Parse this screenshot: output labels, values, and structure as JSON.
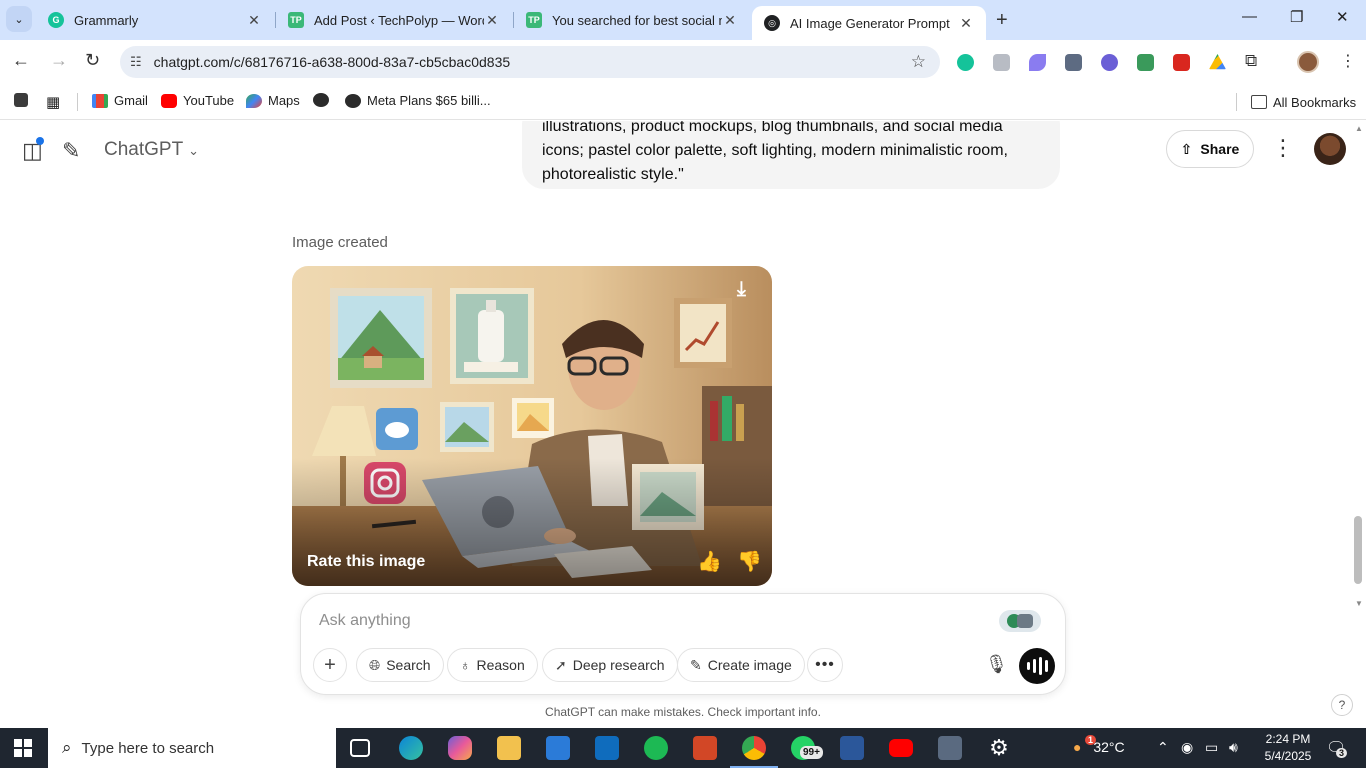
{
  "browser": {
    "tabs": [
      {
        "title": "Grammarly",
        "favicon": "grammarly-icon",
        "color": "#15c39a"
      },
      {
        "title": "Add Post ‹ TechPolyp — WordP",
        "favicon": "techpolyp-icon",
        "color": "#3bb878"
      },
      {
        "title": "You searched for best social me",
        "favicon": "techpolyp-icon",
        "color": "#3bb878"
      },
      {
        "title": "AI Image Generator Prompt",
        "favicon": "chatgpt-icon",
        "color": "#202123"
      }
    ],
    "url": "chatgpt.com/c/68176716-a638-800d-83a7-cb5cbac0d835",
    "bookmarks": [
      {
        "label": "Gmail",
        "icon": "gmail-icon"
      },
      {
        "label": "YouTube",
        "icon": "youtube-icon"
      },
      {
        "label": "Maps",
        "icon": "maps-icon"
      },
      {
        "label": "",
        "icon": "globe-icon"
      },
      {
        "label": "Meta Plans $65 billi...",
        "icon": "globe-icon"
      }
    ],
    "all_bookmarks": "All Bookmarks"
  },
  "chat": {
    "model": "ChatGPT",
    "share_label": "Share",
    "user_message": "illustrations, product mockups, blog thumbnails, and social media icons; pastel color palette, soft lighting, modern minimalistic room, photorealistic style.\"",
    "image_created_label": "Image created",
    "rate_label": "Rate this image",
    "composer": {
      "placeholder": "Ask anything",
      "buttons": [
        "Search",
        "Reason",
        "Deep research",
        "Create image"
      ]
    },
    "disclaimer": "ChatGPT can make mistakes. Check important info.",
    "help": "?"
  },
  "taskbar": {
    "search_placeholder": "Type here to search",
    "whatsapp_badge": "99+",
    "weather": "32°C",
    "weather_badge": "1",
    "time": "2:24 PM",
    "date": "5/4/2025",
    "notifications": "3"
  }
}
